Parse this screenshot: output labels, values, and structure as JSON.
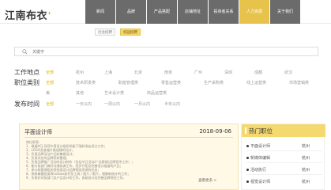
{
  "logo": "江南布衣",
  "logo_mark": "+",
  "nav": [
    "新闻",
    "品牌",
    "产品搭配",
    "店铺地址",
    "投资者关系",
    "人力资源",
    "关于我们"
  ],
  "nav_active_index": 5,
  "subtabs": [
    "社会招聘",
    "校园招聘"
  ],
  "subtab_active_index": 1,
  "search": {
    "placeholder": "关键字"
  },
  "filters": {
    "location": {
      "label": "工作地点",
      "options": [
        "全部",
        "杭州",
        "上海",
        "北京",
        "南京",
        "广州",
        "深圳",
        "成都",
        "武汉"
      ]
    },
    "category": {
      "label": "职位类别",
      "options": [
        "全部",
        "技术研发类",
        "职能管理类",
        "零售运营类",
        "生产采购类",
        "线上运营类",
        "市场营销类",
        "",
        "美",
        "其他",
        "艺术设计类",
        "商品运营类"
      ]
    },
    "time": {
      "label": "发布时间",
      "options": [
        "全部",
        "一天以内",
        "一周以内",
        "一月以内",
        "半年以内"
      ]
    }
  },
  "job": {
    "title": "平面设计师",
    "date": "2018-09-06",
    "duties": [
      "岗位职责：",
      "1、根据ACJ 及阿尔塔设计组织机能下强料场店设计工作；",
      "2、LOGO及各服片推组模的设计；",
      "3、负责品牌活动产品料集格设计；",
      "4、负责对应的品牌资料整理；",
      "5、负责品牌推广活动的设计制作（包括节日活动/广告影册/品牌宣传工作）；",
      "6、能与各部门做好沟通协调工作，逐步开拓及完善设计维度的产品；",
      "7、参与和管理相关视觉类设计品牌视觉资源的任务；",
      "8、熟练掌握各类Windows软件及工具 / 图片 / 影片，理解新统计的工作；",
      "9、负责好对各部门及产品设计的工作，协助设计及完善品牌视觉工作。"
    ],
    "more_label": "查看更多 >"
  },
  "hot": {
    "title": "热门职位",
    "items": [
      {
        "name": "平面设计师",
        "city": "杭州"
      },
      {
        "name": "新媒体编辑",
        "city": "杭州"
      },
      {
        "name": "活动执行",
        "city": "杭州"
      },
      {
        "name": "视觉设计师",
        "city": "杭州"
      }
    ]
  },
  "colors": {
    "accent": "#e7c34c",
    "nav_bg": "#6b6b6b",
    "card_bg": "#fff9e6"
  }
}
